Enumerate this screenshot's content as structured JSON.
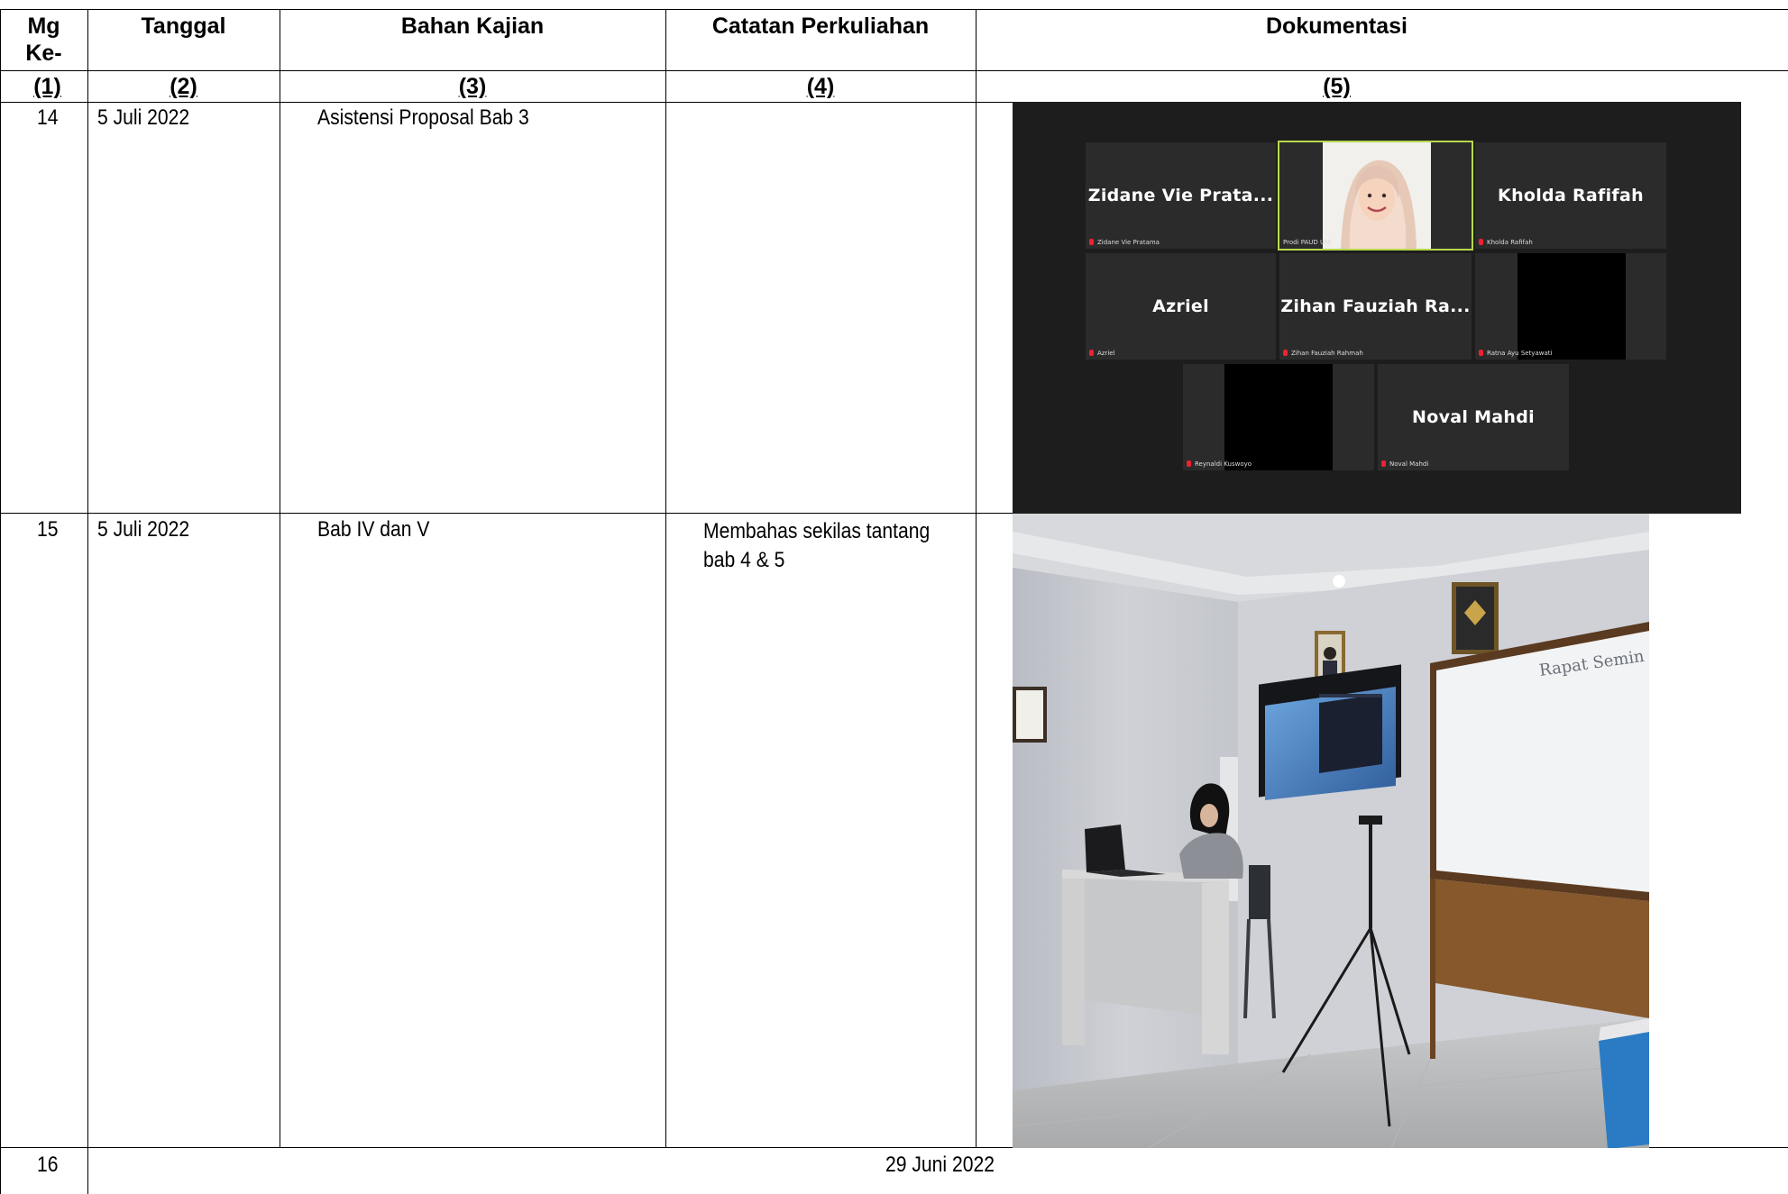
{
  "header": {
    "col1": "Mg Ke-",
    "col2": "Tanggal",
    "col3": "Bahan Kajian",
    "col4": "Catatan Perkuliahan",
    "col5": "Dokumentasi"
  },
  "numbering": [
    "(1)",
    "(2)",
    "(3)",
    "(4)",
    "(5)"
  ],
  "rows": [
    {
      "week": "14",
      "date": "5 Juli 2022",
      "material": "Asistensi Proposal Bab 3",
      "notes": ""
    },
    {
      "week": "15",
      "date": "5 Juli 2022",
      "material": "Bab IV dan V",
      "notes_line1": "Membahas sekilas tantang",
      "notes_line2": "bab 4 & 5"
    },
    {
      "week": "16",
      "date": "29  Juni 2022"
    }
  ],
  "zoom": {
    "tiles": [
      {
        "display": "Zidane Vie Prata...",
        "small": "Zidane Vie Pratama"
      },
      {
        "display": "",
        "small": "Prodi PAUD UNJ"
      },
      {
        "display": "Kholda Rafifah",
        "small": "Kholda Rafifah"
      },
      {
        "display": "Azriel",
        "small": "Azriel"
      },
      {
        "display": "Zihan Fauziah Ra...",
        "small": "Zihan Fauziah Rahmah"
      },
      {
        "display": "",
        "small": "Ratna Ayu Setyawati"
      },
      {
        "display": "",
        "small": "Reynaldi Kuswoyo"
      },
      {
        "display": "Noval Mahdi",
        "small": "Noval Mahdi"
      }
    ]
  },
  "photo": {
    "whiteboard_text": "Rapat Semin"
  }
}
